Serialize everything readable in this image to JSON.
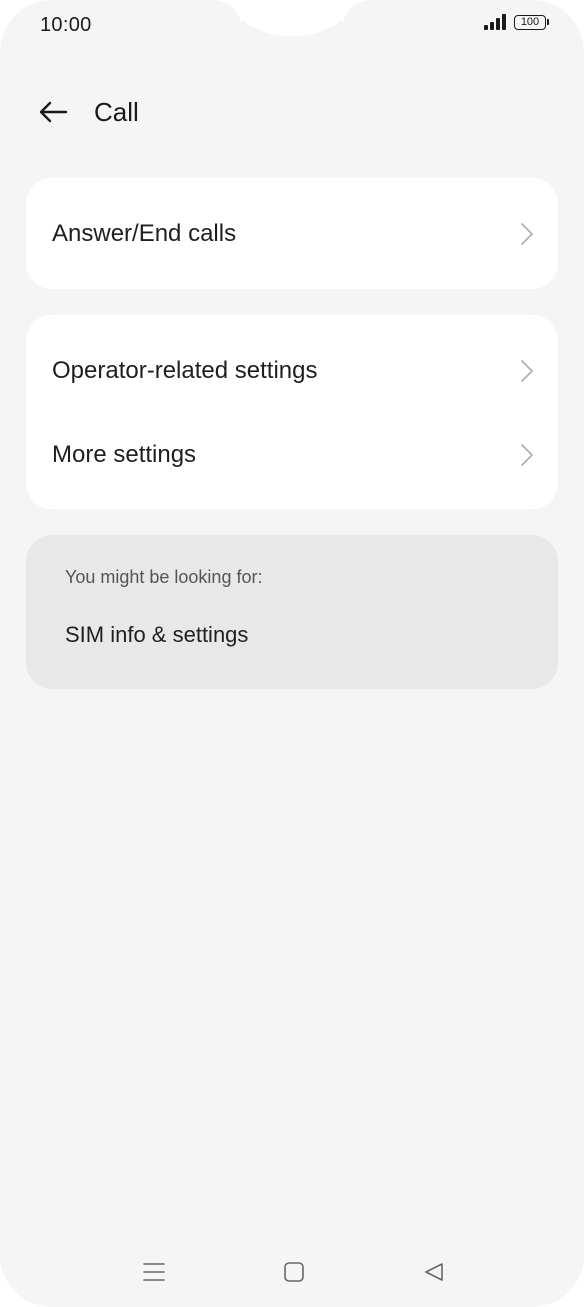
{
  "status_bar": {
    "time": "10:00",
    "battery": "100"
  },
  "header": {
    "title": "Call",
    "back_icon": "arrow-left-icon"
  },
  "groups": [
    {
      "items": [
        {
          "label": "Answer/End calls",
          "icon": "chevron-right-icon"
        }
      ]
    },
    {
      "items": [
        {
          "label": "Operator-related settings",
          "icon": "chevron-right-icon"
        },
        {
          "label": "More settings",
          "icon": "chevron-right-icon"
        }
      ]
    }
  ],
  "suggestions": {
    "heading": "You might be looking for:",
    "items": [
      {
        "label": "SIM info & settings"
      }
    ]
  },
  "navbar": {
    "icons": [
      "menu-icon",
      "home-icon",
      "back-triangle-icon"
    ]
  },
  "colors": {
    "background": "#f5f5f5",
    "card": "#ffffff",
    "suggestion_card": "#e8e8e8",
    "text_primary": "#1f1f1f",
    "text_secondary": "#555555",
    "chevron": "#b0b0b0"
  }
}
